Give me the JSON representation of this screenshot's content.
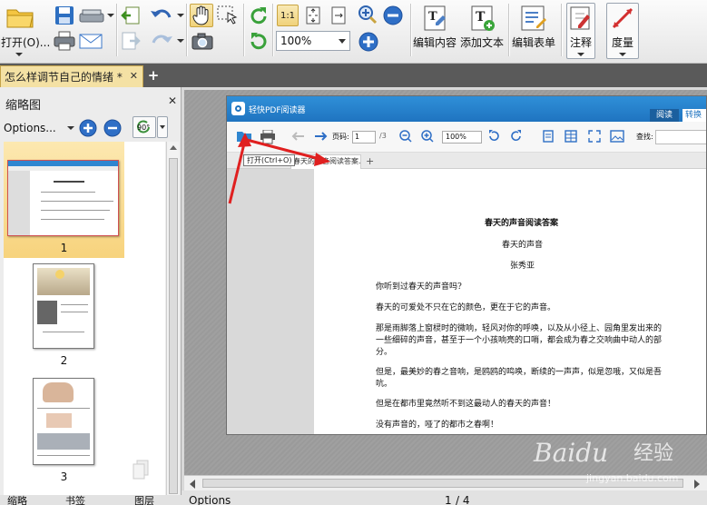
{
  "toolbar": {
    "open_label": "打开(O)...",
    "zoom_value": "100%",
    "edit_content_label": "编辑内容",
    "add_text_label": "添加文本",
    "edit_form_label": "编辑表单",
    "annotate_label": "注释",
    "measure_label": "度量",
    "actual_size_label": "1:1"
  },
  "tabs": {
    "doc_tab_label": "怎么样调节自己的情绪 *"
  },
  "thumbnails": {
    "title": "缩略图",
    "options_label": "Options...",
    "rotate_label": "90°",
    "pages": [
      {
        "number": "1",
        "selected": true
      },
      {
        "number": "2",
        "selected": false
      },
      {
        "number": "3",
        "selected": false
      }
    ]
  },
  "embedded": {
    "app_name": "轻快PDF阅读器",
    "mode_read": "阅读",
    "mode_convert": "转换",
    "page_label": "页码:",
    "page_value": "1",
    "page_total": "/3",
    "zoom_value": "100%",
    "search_label": "查找:",
    "tooltip": "打开(Ctrl+O)",
    "tab_label": "春天的声音阅读答案.pdf",
    "doc": {
      "heading": "春天的声音阅读答案",
      "subtitle": "春天的声音",
      "author": "张秀亚",
      "p1": "你听到过春天的声音吗?",
      "p2": "春天的可爱处不只在它的颜色，更在于它的声音。",
      "p3a": "那是雨脚落上窗棂时的微响，轻风对你的呼唤，以及从小径上、园角里发出来的",
      "p3b": "一些细碎的声音，甚至于一个小孩响亮的口哨，都会成为春之交响曲中动人的部",
      "p3c": "分。",
      "p4a": "但是，最美妙的春之音响，是鸥鸥的鸣唤，断续的一声声，似是忽哦，又似是吾",
      "p4b": "吭。",
      "p5": "但是在都市里竟然听不到这最动人的春天的声音！",
      "p6": "没有声音的，哑了的都市之春啊！"
    }
  },
  "bottom": {
    "options_label": "Options",
    "page_value": "1",
    "page_total": "/ 4",
    "left_tabs_1": "缩略",
    "left_tabs_2": "书签",
    "left_tabs_3": "图层"
  },
  "watermark": {
    "brand": "Baidu",
    "brand_cn": "经验",
    "url": "jingyan.baidu.com"
  },
  "colors": {
    "accent": "#1f74c0",
    "tab_active": "#f4e1a4",
    "arrow_red": "#e02020"
  }
}
